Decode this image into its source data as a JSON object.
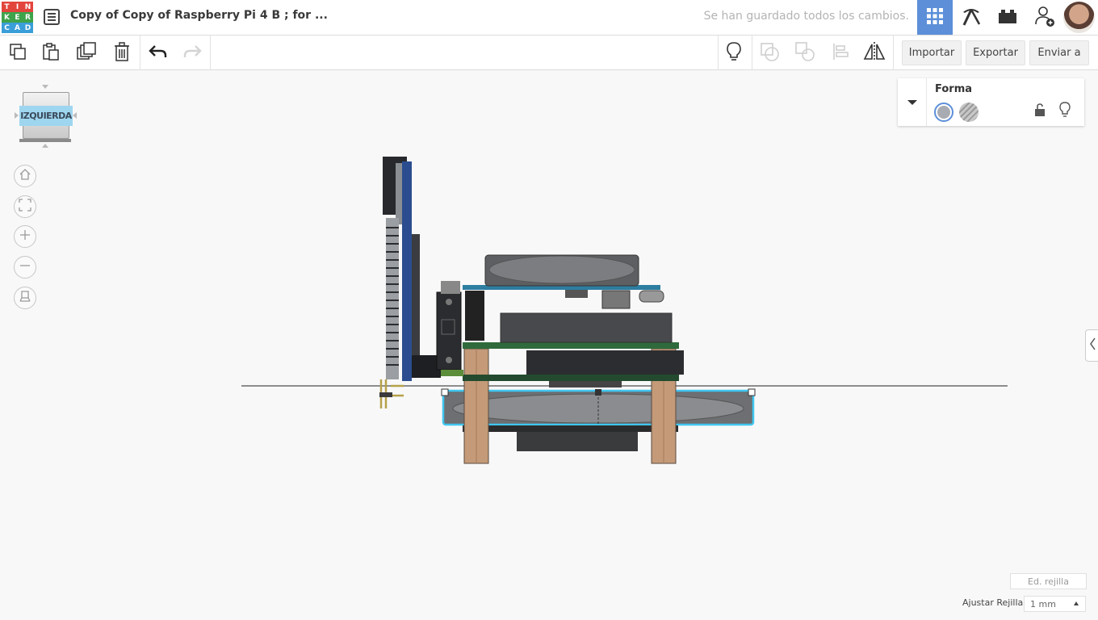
{
  "app": {
    "logo_letters": [
      "T",
      "I",
      "N",
      "K",
      "E",
      "R",
      "C",
      "A",
      "D"
    ],
    "logo_colors": [
      "#e2453c",
      "#e2453c",
      "#e2453c",
      "#f2a33a",
      "#f2a33a",
      "#f2a33a",
      "#3a9ed8",
      "#3a9ed8",
      "#3a9ed8"
    ],
    "logo_label_colors": [
      "#e2453c",
      "#e2453c",
      "#e2453c",
      "#3ea34a",
      "#3ea34a",
      "#3ea34a",
      "#3a9ed8",
      "#3a9ed8",
      "#3a9ed8"
    ],
    "design_title": "Copy of Copy of Raspberry Pi 4 B ; for ...",
    "save_status": "Se han guardado todos los cambios.",
    "accent_color": "#5c8fd8"
  },
  "header_buttons": [
    {
      "name": "3d-design-view",
      "icon": "grid-icon",
      "active": true
    },
    {
      "name": "codeblocks-view",
      "icon": "pickaxe-icon",
      "active": false
    },
    {
      "name": "bricks-view",
      "icon": "bricks-icon",
      "active": false
    },
    {
      "name": "invite",
      "icon": "add-user-icon",
      "active": false
    }
  ],
  "toolbar": {
    "import_label": "Importar",
    "export_label": "Exportar",
    "send_label": "Enviar a"
  },
  "viewcube": {
    "face_label": "IZQUIERDA"
  },
  "inspector": {
    "title": "Forma",
    "solid_color": "#a8acb2",
    "hole_color": "#b5b5b5"
  },
  "grid": {
    "edit_label": "Ed. rejilla",
    "snap_label": "Ajustar Rejilla",
    "snap_value": "1 mm"
  }
}
